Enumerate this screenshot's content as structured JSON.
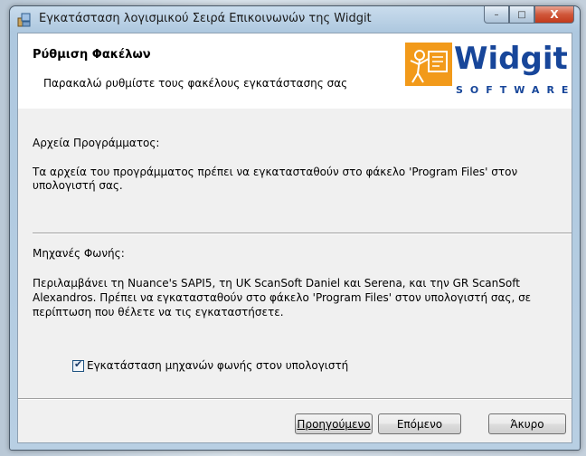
{
  "window": {
    "title": "Εγκατάσταση λογισμικού Σειρά Επικοινωνών της Widgit",
    "minimize_glyph": "–",
    "maximize_glyph": "□",
    "close_glyph": "X"
  },
  "banner": {
    "title": "Ρύθμιση Φακέλων",
    "subtitle": "Παρακαλώ ρυθμίστε τους φακέλους εγκατάστασης σας",
    "logo_text": "Widgit",
    "logo_subtext": "SOFTWARE"
  },
  "program": {
    "label": "Αρχεία Προγράμματος:",
    "description": "Τα αρχεία του προγράμματος πρέπει να εγκατασταθούν στο φάκελο 'Program Files' στον υπολογιστή σας."
  },
  "voices": {
    "label": "Μηχανές Φωνής:",
    "description": "Περιλαμβάνει τη Nuance's SAPI5, τη UK ScanSoft Daniel και Serena, και την GR ScanSoft Alexandros. Πρέπει να εγκατασταθούν στο φάκελο 'Program Files' στον υπολογιστή σας, σε περίπτωση που θέλετε να τις εγκαταστήσετε.",
    "checkbox_label": "Εγκατάσταση μηχανών φωνής στον υπολογιστή",
    "checkbox_checked": true
  },
  "buttons": {
    "back": "Προηγούμενο",
    "next": "Επόμενο",
    "cancel": "Άκυρο"
  },
  "colors": {
    "brand": "#17469a",
    "logo_orange": "#f29a1a"
  }
}
